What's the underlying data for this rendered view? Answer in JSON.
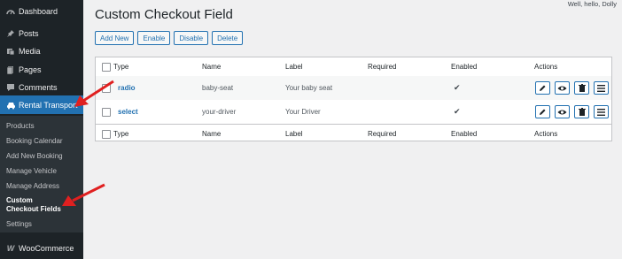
{
  "admin_bar": {
    "howdy": "Well, hello, Dolly"
  },
  "sidebar": {
    "items": [
      {
        "label": "Dashboard",
        "icon": "dashboard-icon"
      },
      {
        "label": "Posts",
        "icon": "pin-icon"
      },
      {
        "label": "Media",
        "icon": "media-icon"
      },
      {
        "label": "Pages",
        "icon": "pages-icon"
      },
      {
        "label": "Comments",
        "icon": "comments-icon"
      },
      {
        "label": "Rental Transport",
        "icon": "car-icon"
      }
    ],
    "submenu": [
      "Products",
      "Booking Calendar",
      "Add New Booking",
      "Manage Vehicle",
      "Manage Address",
      "Custom Checkout Fields",
      "Settings"
    ],
    "bottom_item": {
      "label": "WooCommerce",
      "icon": "woocommerce-icon"
    }
  },
  "page": {
    "title": "Custom Checkout Field",
    "buttons": {
      "add_new": "Add New",
      "enable": "Enable",
      "disable": "Disable",
      "delete": "Delete"
    }
  },
  "table": {
    "columns": [
      "Type",
      "Name",
      "Label",
      "Required",
      "Enabled",
      "Actions"
    ],
    "rows": [
      {
        "type": "radio",
        "name": "baby-seat",
        "label": "Your baby seat",
        "required": "",
        "enabled": "✔"
      },
      {
        "type": "select",
        "name": "your-driver",
        "label": "Your Driver",
        "required": "",
        "enabled": "✔"
      }
    ]
  },
  "colors": {
    "accent": "#2271b1",
    "sidebar": "#1d2327",
    "arrow": "#e02020"
  }
}
